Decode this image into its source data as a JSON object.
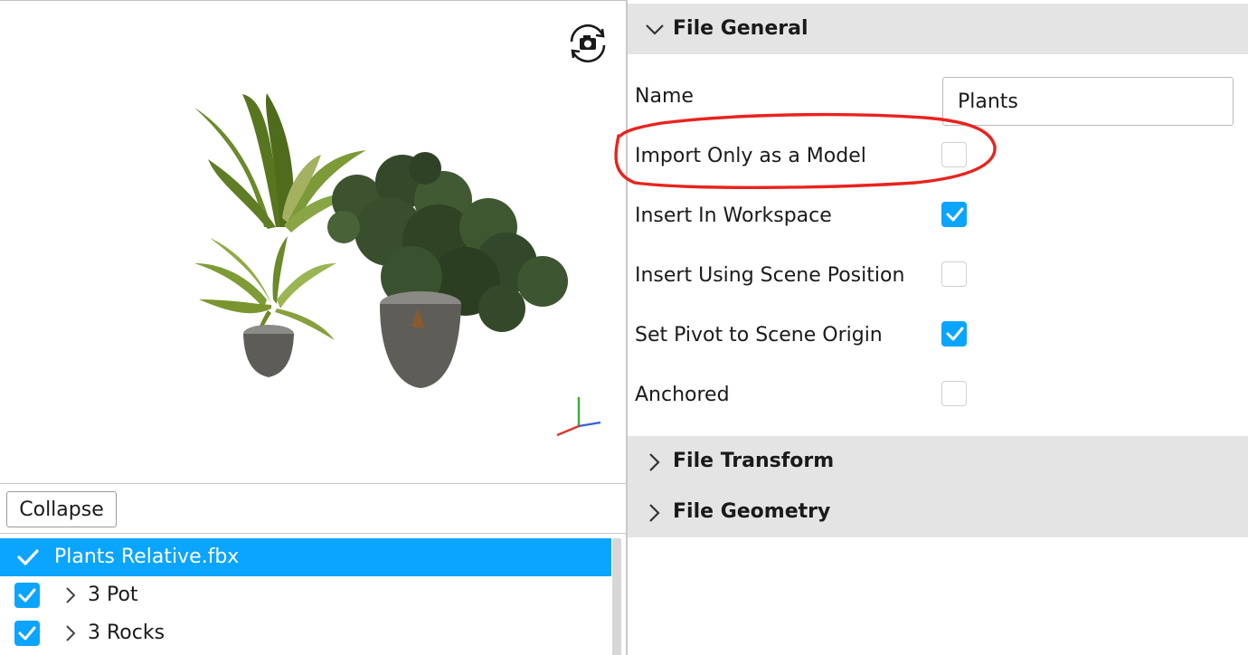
{
  "colors": {
    "accent": "#0ba4ff",
    "section_header_bg": "#e4e4e4",
    "annotation": "#e8231e"
  },
  "icons": {
    "camera": "rotate-camera-icon",
    "axis": "axis-gizmo-icon",
    "check": "checkmark-icon",
    "chevron_down": "chevron-down-icon",
    "chevron_right": "chevron-right-icon"
  },
  "left": {
    "collapse_label": "Collapse",
    "tree": [
      {
        "label": "Plants Relative.fbx",
        "selected": true
      },
      {
        "label": "3 Pot",
        "checked": true
      },
      {
        "label": "3 Rocks",
        "checked": true
      }
    ]
  },
  "right": {
    "file_general": {
      "title": "File General",
      "expanded": true,
      "name_label": "Name",
      "name_value": "Plants",
      "props": [
        {
          "label": "Import Only as a Model",
          "checked": false
        },
        {
          "label": "Insert In Workspace",
          "checked": true
        },
        {
          "label": "Insert Using Scene Position",
          "checked": false
        },
        {
          "label": "Set Pivot to Scene Origin",
          "checked": true
        },
        {
          "label": "Anchored",
          "checked": false
        }
      ]
    },
    "file_transform": {
      "title": "File Transform",
      "expanded": false
    },
    "file_geometry": {
      "title": "File Geometry",
      "expanded": false
    }
  }
}
